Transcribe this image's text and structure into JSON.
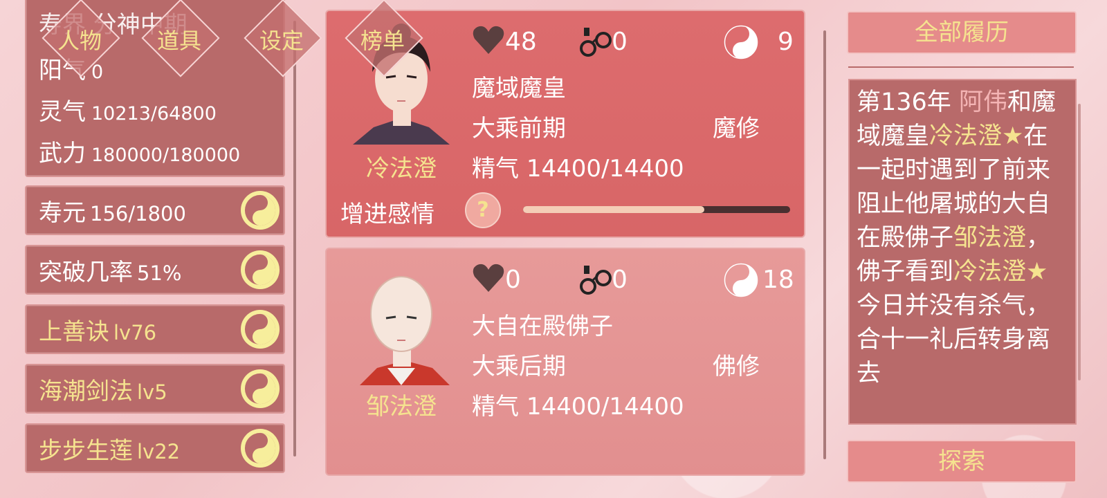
{
  "nav": [
    "人物",
    "道具",
    "设定",
    "榜单"
  ],
  "stats": {
    "partial_top": "寿界 分神中期",
    "yang_label": "阳气",
    "yang_value": "0",
    "lingqi_label": "灵气",
    "lingqi_value": "10213/64800",
    "wuli_label": "武力",
    "wuli_value": "180000/180000"
  },
  "bars": [
    {
      "label": "寿元",
      "value": "156/1800",
      "gold": false
    },
    {
      "label": "突破几率",
      "value": "51%",
      "gold": false
    },
    {
      "label": "上善诀",
      "value": "lv76",
      "gold": true
    },
    {
      "label": "海潮剑法",
      "value": "lv5",
      "gold": true
    },
    {
      "label": "步步生莲",
      "value": "lv22",
      "gold": true
    }
  ],
  "characters": [
    {
      "name": "冷法澄",
      "heart": "48",
      "cuffs": "0",
      "yinyang": "9",
      "title": "魔域魔皇",
      "realm": "大乘前期",
      "sect": "魔修",
      "jingqi_label": "精气",
      "jingqi": "14400/14400",
      "affection_label": "增进感情",
      "affection_progress": 0.68
    },
    {
      "name": "邹法澄",
      "heart": "0",
      "cuffs": "0",
      "yinyang": "18",
      "title": "大自在殿佛子",
      "realm": "大乘后期",
      "sect": "佛修",
      "jingqi_label": "精气",
      "jingqi": "14400/14400"
    }
  ],
  "right": {
    "history_button": "全部履历",
    "explore_button": "探索",
    "history": {
      "p1": "第136年 ",
      "p2": "阿伟",
      "p3": "和魔域魔皇",
      "p4": "冷法澄",
      "p5": "★",
      "p6": "在一起时遇到了前来阻止他屠城的大自在殿佛子",
      "p7": "邹法澄",
      "p8": "，佛子看到",
      "p9": "冷法澄",
      "p10": "★",
      "p11": "今日并没有杀气，合十一礼后转身离去"
    }
  },
  "colors": {
    "gold": "#f5e38f",
    "panel": "#b86a6a",
    "card_top": "#dd6c6e",
    "card_bottom": "#e79a99"
  }
}
